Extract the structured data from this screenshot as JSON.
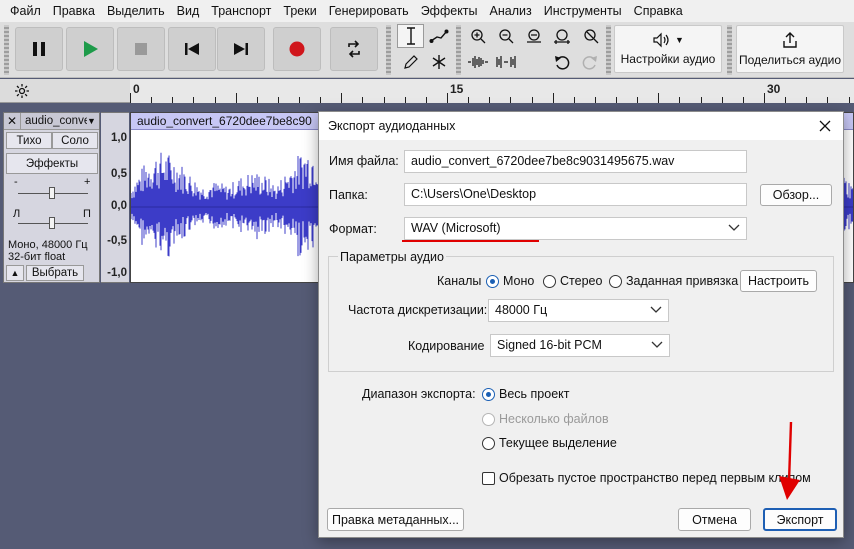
{
  "menu": [
    "Файл",
    "Правка",
    "Выделить",
    "Вид",
    "Транспорт",
    "Треки",
    "Генерировать",
    "Эффекты",
    "Анализ",
    "Инструменты",
    "Справка"
  ],
  "toolbar": {
    "audio_settings_label": "Настройки аудио",
    "share_label": "Поделиться аудио"
  },
  "ruler": {
    "labels": [
      "0",
      "15",
      "30"
    ]
  },
  "track": {
    "name": "audio_conve",
    "close": "✕",
    "mute_label": "Тихо",
    "solo_label": "Соло",
    "effects_label": "Эффекты",
    "gain_minus": "-",
    "gain_plus": "+",
    "pan_left": "Л",
    "pan_right": "П",
    "info_line1": "Моно, 48000 Гц",
    "info_line2": "32-бит float",
    "collapse": "▲",
    "select_label": "Выбрать",
    "clip_name": "audio_convert_6720dee7be8c90",
    "scale": [
      "1,0",
      "0,5",
      "0,0",
      "-0,5",
      "-1,0"
    ]
  },
  "dialog": {
    "title": "Экспорт аудиоданных",
    "filename_label": "Имя файла:",
    "filename_value": "audio_convert_6720dee7be8c9031495675.wav",
    "folder_label": "Папка:",
    "folder_value": "C:\\Users\\One\\Desktop",
    "browse_label": "Обзор...",
    "format_label": "Формат:",
    "format_value": "WAV (Microsoft)",
    "audio_params_title": "Параметры аудио",
    "channels_label": "Каналы",
    "channel_mono": "Моно",
    "channel_stereo": "Стерео",
    "channel_custom": "Заданная привязка",
    "configure_label": "Настроить",
    "samplerate_label": "Частота дискретизации:",
    "samplerate_value": "48000 Гц",
    "encoding_label": "Кодирование",
    "encoding_value": "Signed 16-bit PCM",
    "range_label": "Диапазон экспорта:",
    "range_whole": "Весь проект",
    "range_multiple": "Несколько файлов",
    "range_selection": "Текущее выделение",
    "trim_label": "Обрезать пустое пространство перед первым клипом",
    "metadata_label": "Правка метаданных...",
    "cancel_label": "Отмена",
    "export_label": "Экспорт"
  },
  "colors": {
    "accent": "#1a5fb4",
    "waveform": "#3c3cc8",
    "annotation": "#e00000"
  }
}
